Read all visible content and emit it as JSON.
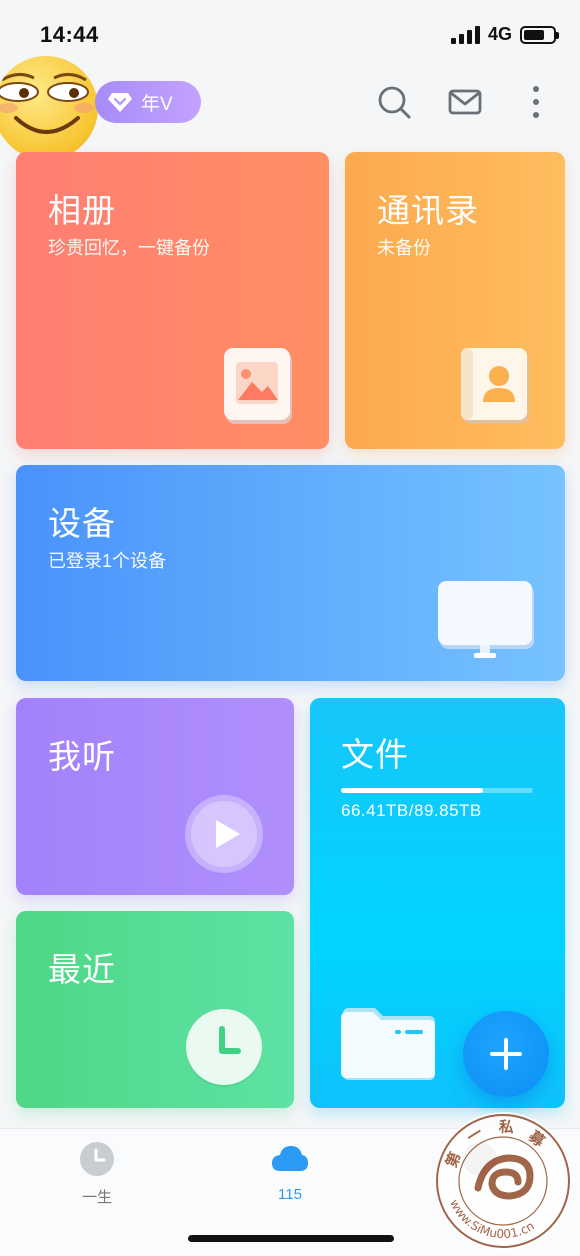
{
  "status_bar": {
    "time": "14:44",
    "network": "4G"
  },
  "header": {
    "vip_label": "年V",
    "icons": [
      "search-icon",
      "mail-icon",
      "more-icon"
    ]
  },
  "cards": {
    "album": {
      "title": "相册",
      "subtitle": "珍贵回忆，一键备份"
    },
    "contacts": {
      "title": "通讯录",
      "subtitle": "未备份"
    },
    "devices": {
      "title": "设备",
      "subtitle": "已登录1个设备"
    },
    "listen": {
      "title": "我听"
    },
    "recent": {
      "title": "最近"
    },
    "files": {
      "title": "文件",
      "storage_text": "66.41TB/89.85TB",
      "used_fraction": 0.739
    }
  },
  "tab_bar": {
    "tabs": [
      {
        "label": "一生",
        "icon": "clock-icon"
      },
      {
        "label": "115",
        "icon": "cloud-icon",
        "active": true
      },
      {
        "label": "",
        "icon": "round-icon"
      }
    ]
  },
  "watermark": {
    "text": "第 一 私 募 www.SiMu001.cn"
  },
  "colors": {
    "album": "#ff8170",
    "contacts": "#fdb257",
    "devices": "#5aa6fc",
    "listen": "#a986fb",
    "recent": "#55dc95",
    "files": "#0ccdfd",
    "fab": "#1298f7",
    "active_tab": "#2a9af5",
    "vip": "#b396fb"
  }
}
